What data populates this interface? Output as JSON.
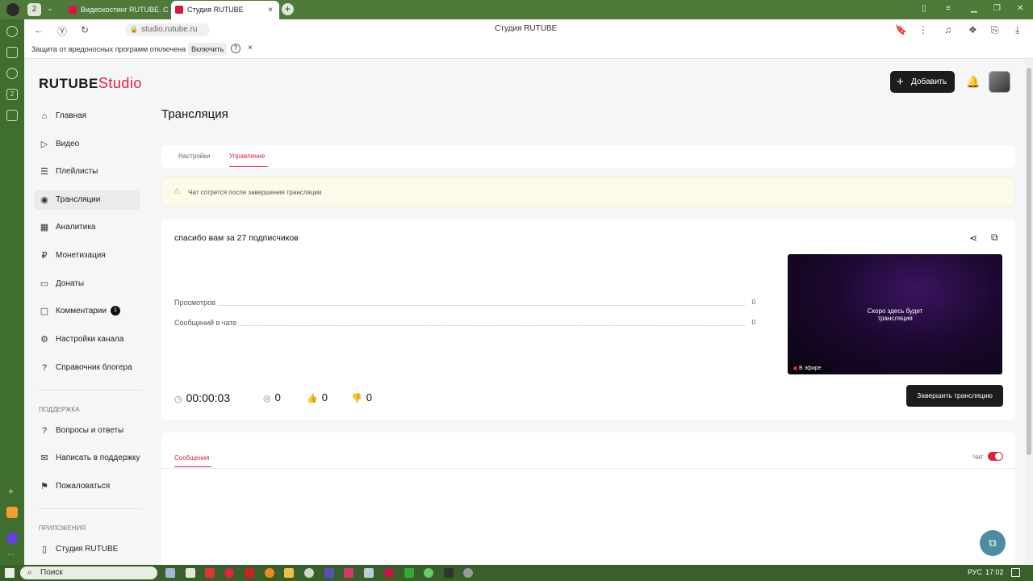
{
  "browser": {
    "profile_badge": "2",
    "tabs": [
      {
        "label": "Видеохостинг RUTUBE. С"
      },
      {
        "label": "Студия RUTUBE",
        "close": "×"
      }
    ],
    "new_tab": "+",
    "address": "studio.rutube.ru",
    "page_title": "Студия RUTUBE",
    "info_bar": {
      "text": "Защита от вредоносных программ отключена",
      "button": "Включить",
      "help": "?",
      "close": "×"
    }
  },
  "header": {
    "logo_main": "RUTUBE",
    "logo_sub": "Studio",
    "add_button": "Добавить"
  },
  "sidebar": {
    "items": [
      {
        "label": "Главная",
        "icon": "home-icon"
      },
      {
        "label": "Видео",
        "icon": "video-icon"
      },
      {
        "label": "Плейлисты",
        "icon": "playlist-icon"
      },
      {
        "label": "Трансляции",
        "icon": "broadcast-icon"
      },
      {
        "label": "Аналитика",
        "icon": "analytics-icon"
      },
      {
        "label": "Монетизация",
        "icon": "ruble-icon"
      },
      {
        "label": "Донаты",
        "icon": "donate-icon"
      },
      {
        "label": "Комментарии",
        "icon": "comment-icon",
        "badge": "1"
      },
      {
        "label": "Настройки канала",
        "icon": "settings-icon"
      },
      {
        "label": "Справочник блогера",
        "icon": "help-icon"
      }
    ],
    "support_title": "Поддержка",
    "support_items": [
      {
        "label": "Вопросы и ответы"
      },
      {
        "label": "Написать в поддержку"
      },
      {
        "label": "Пожаловаться"
      }
    ],
    "apps_title": "Приложения",
    "apps_items": [
      {
        "label": "Студия RUTUBE"
      }
    ]
  },
  "main": {
    "title": "Трансляция",
    "tabs": [
      {
        "label": "Настройки",
        "active": false
      },
      {
        "label": "Управление",
        "active": true
      }
    ],
    "warning": "Чат сотрется после завершения трансляции",
    "stream": {
      "title": "спасибо вам за 27 подписчиков",
      "stats": [
        {
          "label": "Просмотров",
          "value": "0"
        },
        {
          "label": "Сообщений в чате",
          "value": "0"
        }
      ],
      "timer": "00:00:03",
      "viewers": "0",
      "likes": "0",
      "dislikes": "0",
      "preview_text": "Скоро здесь будет трансляция",
      "live_label": "В эфире",
      "end_button": "Завершить трансляцию"
    },
    "chat": {
      "tab_label": "Сообщения",
      "toggle_label": "Чат",
      "toggle_on": true
    }
  },
  "taskbar": {
    "search": "Поиск",
    "lang": "РУС",
    "time": "17:02"
  },
  "colors": {
    "accent": "#e0223f",
    "dark_button": "#1c1c1e",
    "browser_frame": "#4f7a3a"
  }
}
